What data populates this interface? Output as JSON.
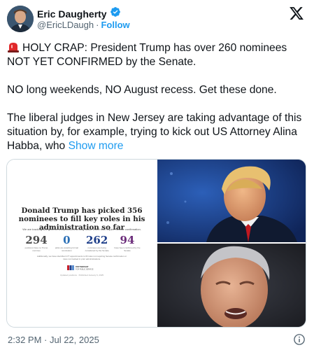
{
  "author": {
    "display_name": "Eric Daugherty",
    "handle": "@EricLDaugh",
    "separator": "·",
    "follow_label": "Follow"
  },
  "icons": {
    "verified": "verified-badge-icon",
    "platform": "x-logo-icon",
    "alert": "police-light-icon",
    "info": "info-icon"
  },
  "tweet": {
    "paragraph_1": "HOLY CRAP: President Trump has over 260 nominees NOT YET CONFIRMED by the Senate.",
    "paragraph_2": "NO long weekends, NO August recess. Get these done.",
    "paragraph_3": "The liberal judges in New Jersey are taking advantage of this situation by, for example, trying to kick out US Attorney Alina Habba, who",
    "show_more": "Show more"
  },
  "media": {
    "infographic": {
      "title": "Donald Trump has picked 356 nominees to fill key roles in his administration so far",
      "subtitle": "We are tracking 822 government positions among about 1,300 that require Senate confirmation.",
      "stats": [
        {
          "number": "294",
          "caption": "positions have no Trump nominee",
          "color": "#4a4a4a"
        },
        {
          "number": "0",
          "caption": "picks are awaiting formal nomination",
          "color": "#2a6fb5"
        },
        {
          "number": "262",
          "caption": "nominees are being considered by the Senate",
          "color": "#1f3f8a"
        },
        {
          "number": "94",
          "caption": "have been confirmed by the Senate",
          "color": "#6b2c7a"
        }
      ],
      "note": "Additionally, we have identified 177 appointments to fill roles not requiring Senate confirmation or roles not tracked in prior administrations.",
      "logo_text": "PARTNERSHIP FOR PUBLIC SERVICE",
      "footer": "Updated positions · Published January 6, 2025"
    }
  },
  "timestamp": "2:32 PM · Jul 22, 2025",
  "colors": {
    "accent": "#1d9bf0",
    "text": "#0f1419",
    "muted": "#536471",
    "border": "#cfd9de"
  }
}
